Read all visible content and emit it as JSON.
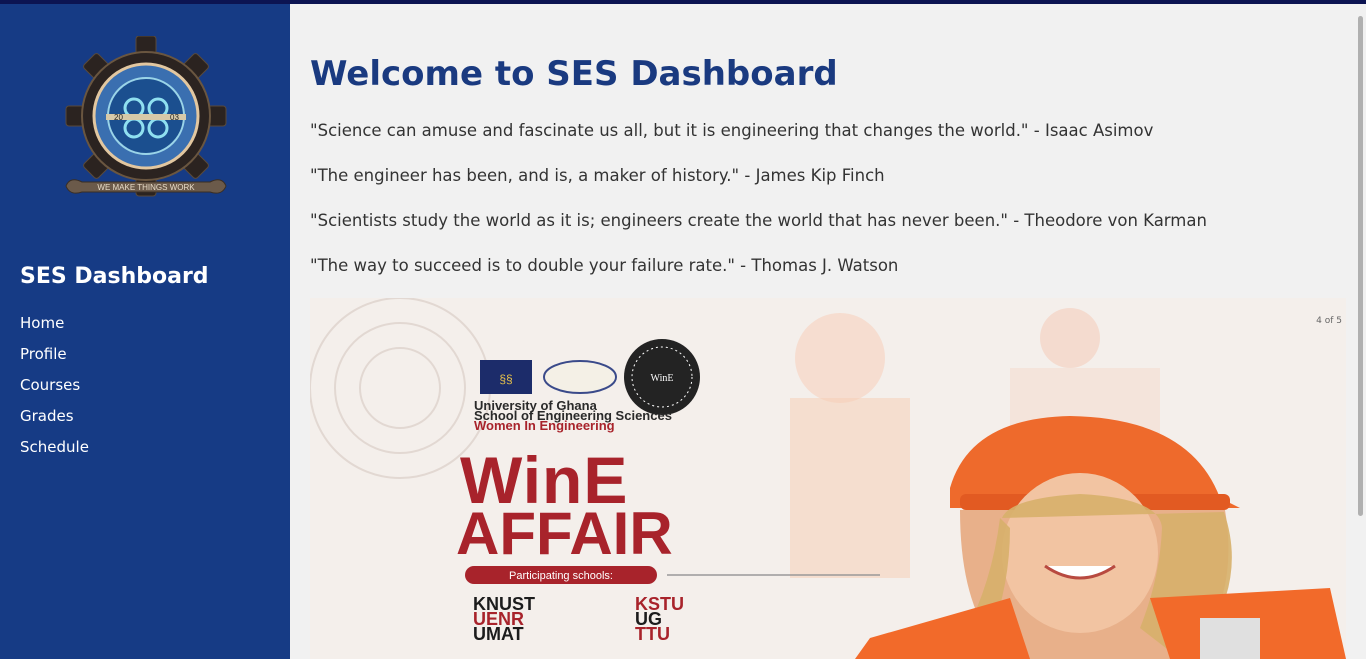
{
  "sidebar": {
    "title": "SES Dashboard",
    "logo_text": "WE MAKE THINGS WORK",
    "nav": [
      "Home",
      "Profile",
      "Courses",
      "Grades",
      "Schedule"
    ]
  },
  "main": {
    "heading": "Welcome to SES Dashboard",
    "quotes": [
      "\"Science can amuse and fascinate us all, but it is engineering that changes the world.\" - Isaac Asimov",
      "\"The engineer has been, and is, a maker of history.\" - James Kip Finch",
      "\"Scientists study the world as it is; engineers create the world that has never been.\" - Theodore von Karman",
      "\"The way to succeed is to double your failure rate.\" - Thomas J. Watson"
    ]
  },
  "slideshow": {
    "counter": "4 of 5",
    "org_line1": "University of Ghana",
    "org_line2": "School of Engineering Sciences",
    "org_line3": "Women In Engineering",
    "title_line1": "WinE",
    "title_line2": "AFFAIR",
    "schools_label": "Participating schools:",
    "schools_col1": [
      "KNUST",
      "UENR",
      "UMAT"
    ],
    "schools_col2": [
      "KSTU",
      "UG",
      "TTU"
    ],
    "badge": "WinE"
  },
  "colors": {
    "sidebar": "#163b85",
    "heading": "#1a3a80",
    "accent_red": "#a8232b",
    "helmet_orange": "#f06a2e"
  }
}
